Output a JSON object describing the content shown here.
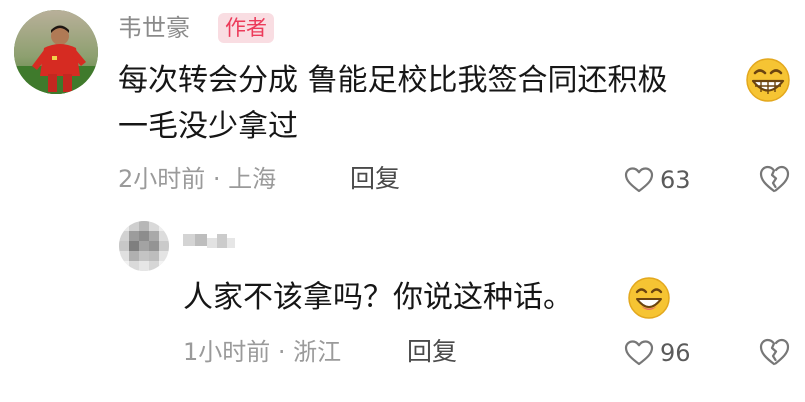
{
  "main_comment": {
    "username": "韦世豪",
    "author_badge": "作者",
    "text": "每次转会分成 鲁能足校比我签合同还积极",
    "text_line2": "一毛没少拿过",
    "emoji": "grinning-squint-emoji",
    "time": "2小时前",
    "separator": " · ",
    "location": "上海",
    "reply_label": "回复",
    "like_count": "63"
  },
  "reply_comment": {
    "text": "人家不该拿吗？你说这种话。",
    "emoji": "grinning-face-emoji",
    "time": "1小时前",
    "separator": " · ",
    "location": "浙江",
    "reply_label": "回复",
    "like_count": "96"
  },
  "icons": {
    "like": "heart-outline-icon",
    "dislike": "broken-heart-outline-icon"
  },
  "colors": {
    "badge_text": "#ec3b5a",
    "badge_bg": "#f9dde2",
    "meta_text": "#9a9a9a",
    "body_text": "#161616",
    "emoji_yellow": "#f6c433"
  }
}
